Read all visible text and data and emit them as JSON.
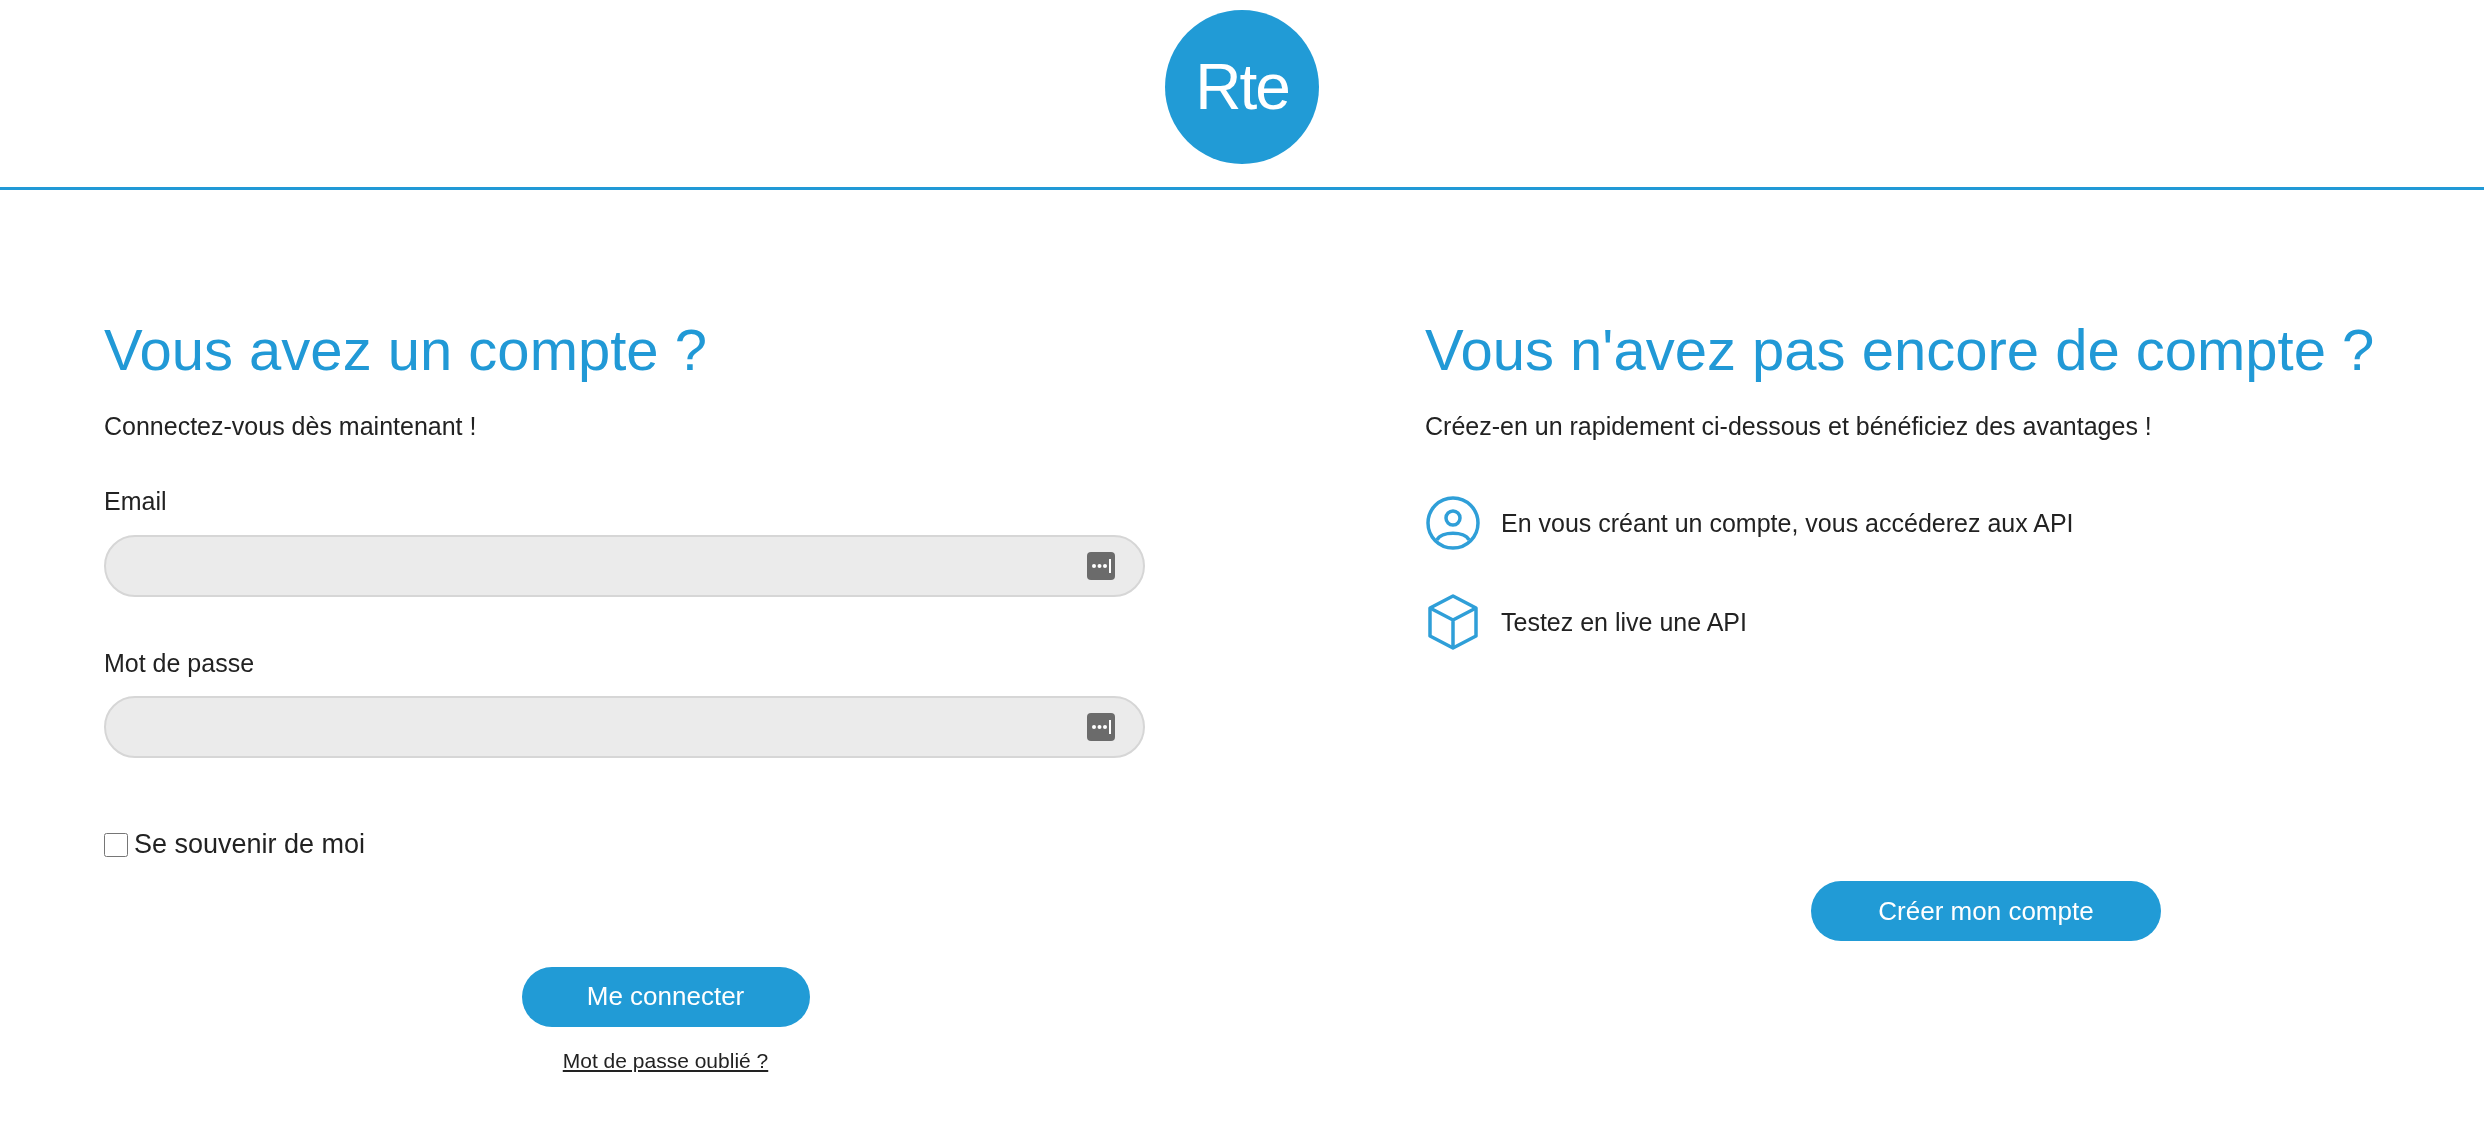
{
  "header": {
    "logo": "Rte"
  },
  "login": {
    "title": "Vous avez un compte ?",
    "subtitle": "Connectez-vous dès maintenant !",
    "fields": [
      {
        "label": "Email"
      },
      {
        "label": "Mot de passe"
      }
    ],
    "remember": {
      "label": "Se souvenir de moi",
      "checked": false
    },
    "button": "Me connecter",
    "forgot": "Mot de passe oublié ?"
  },
  "signup": {
    "title": "Vous n'avez pas encore de compte ?",
    "subtitle": "Créez-en un rapidement ci-dessous et bénéficiez des avantages !",
    "benefits": [
      {
        "kind": "user",
        "text": "En vous créant un compte, vous accéderez aux API"
      },
      {
        "kind": "cube",
        "text": "Testez en live une API"
      }
    ],
    "button": "Créer mon compte"
  }
}
